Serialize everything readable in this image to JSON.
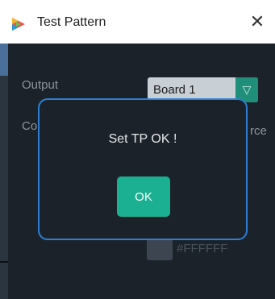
{
  "window": {
    "title": "Test Pattern",
    "close_symbol": "✕"
  },
  "form": {
    "output_label": "Output",
    "output_value": "Board 1",
    "dropdown_arrow": "▽",
    "partial_left_label": "Co",
    "partial_right_label": "rce",
    "color_hex": "#FFFFFF"
  },
  "dialog": {
    "message": "Set TP OK !",
    "ok_label": "OK"
  },
  "colors": {
    "accent": "#1bb092",
    "dialog_border": "#2f7fd6",
    "background": "#1b2229"
  }
}
